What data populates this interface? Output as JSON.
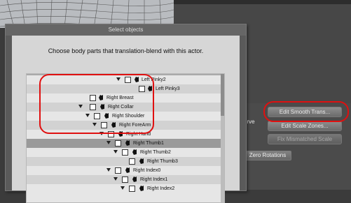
{
  "dialog": {
    "title": "Select objects",
    "prompt": "Choose body parts that translation-blend with this actor."
  },
  "tree_rows": [
    {
      "label": "Left Pinky2"
    },
    {
      "label": "Left Pinky3"
    },
    {
      "label": "Right Breast"
    },
    {
      "label": "Right Collar"
    },
    {
      "label": "Right Shoulder"
    },
    {
      "label": "Right ForeArm"
    },
    {
      "label": "Right Hand"
    },
    {
      "label": "Right Thumb1"
    },
    {
      "label": "Right Thumb2"
    },
    {
      "label": "Right Thumb3"
    },
    {
      "label": "Right Index0"
    },
    {
      "label": "Right Index1"
    },
    {
      "label": "Right Index2"
    }
  ],
  "side_panel": {
    "edit_smooth_trans": "Edit Smooth Trans...",
    "edit_scale_zones": "Edit Scale Zones...",
    "fix_mismatched_scale": "Fix Mismatched Scale",
    "curve_label": "urve",
    "zero_rotations": "Zero Rotations"
  },
  "colors": {
    "highlight": "#e01010",
    "dialog_bg": "#d6d6d6",
    "panel_bg": "#474747"
  }
}
